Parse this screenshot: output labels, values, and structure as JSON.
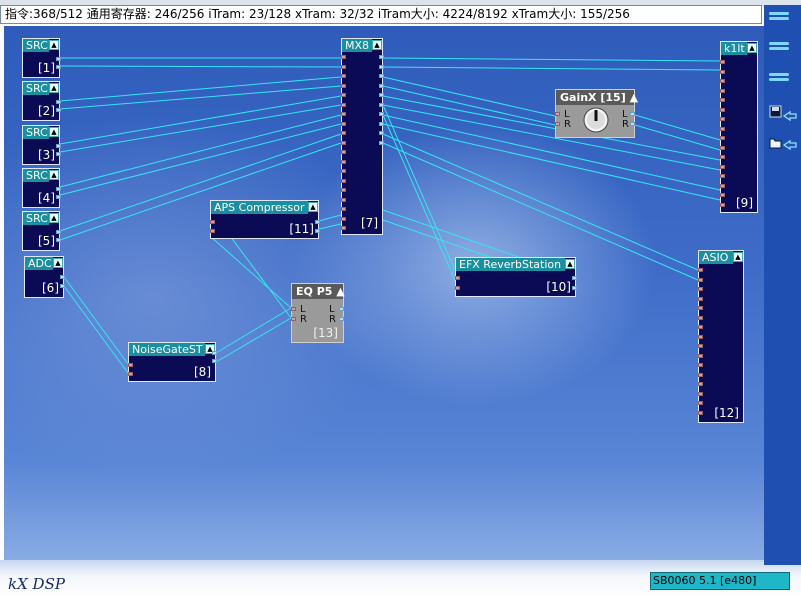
{
  "status": {
    "text": "指令:368/512 通用寄存器: 246/256 iTram: 23/128 xTram: 32/32 iTram大小: 4224/8192 xTram大小: 155/256"
  },
  "modules": {
    "src1": {
      "title": "SRC",
      "index": "[1]"
    },
    "src2": {
      "title": "SRC",
      "index": "[2]"
    },
    "src3": {
      "title": "SRC",
      "index": "[3]"
    },
    "src4": {
      "title": "SRC",
      "index": "[4]"
    },
    "src5": {
      "title": "SRC",
      "index": "[5]"
    },
    "adc": {
      "title": "ADC",
      "index": "[6]"
    },
    "mx8": {
      "title": "MX8",
      "index": "[7]"
    },
    "noisegate": {
      "title": "NoiseGateST",
      "index": "[8]"
    },
    "k1lt": {
      "title": "k1lt",
      "index": "[9]"
    },
    "efxreverb": {
      "title": "EFX ReverbStation",
      "index": "[10]"
    },
    "aps": {
      "title": "APS Compressor",
      "index": "[11]"
    },
    "asio": {
      "title": "ASIO",
      "index": "[12]"
    },
    "eqp5": {
      "title": "EQ P5",
      "index": "[13]",
      "in_l": "L",
      "in_r": "R",
      "out_l": "L",
      "out_r": "R"
    },
    "gainx": {
      "title": "GainX [15]",
      "in_l": "L",
      "in_r": "R",
      "out_l": "L",
      "out_r": "R"
    }
  },
  "colors": {
    "wire": "#35e6f0",
    "module_bg": "#0a0a55",
    "header": "#1a8fa0",
    "version_bg": "#1fb6c8"
  },
  "sidebar": {
    "icons": [
      "menu-lines-icon",
      "menu-lines-icon",
      "menu-lines-icon",
      "save-icon",
      "open-folder-icon"
    ]
  },
  "footer": {
    "logo": "kX DSP",
    "version": "SB0060 5.1 [e480]"
  }
}
